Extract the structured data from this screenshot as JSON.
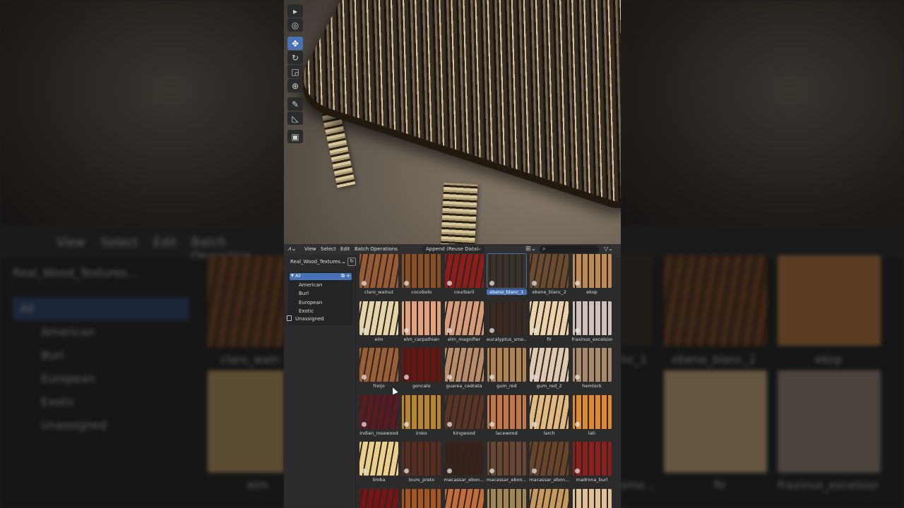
{
  "background_left": {
    "menu": [
      "View",
      "Select",
      "Edit",
      "Batch Operation"
    ],
    "library": "Real_Wood_Textures...",
    "categories": [
      "All",
      "American",
      "Burl",
      "European",
      "Exotic",
      "Unassigned"
    ],
    "labels": [
      "claro_waln",
      "elm"
    ]
  },
  "background_right": {
    "labels": [
      "nc_1",
      "ebene_blanc_2",
      "ekop",
      "smo...",
      "fir",
      "fraxinus_excelsior"
    ]
  },
  "viewport": {
    "tools": [
      "select-box",
      "cursor",
      "move",
      "rotate",
      "scale",
      "transform",
      "annotate",
      "measure",
      "add-cube"
    ],
    "active_tool": "move"
  },
  "asset_browser": {
    "menu": [
      "View",
      "Select",
      "Edit",
      "Batch Operations"
    ],
    "import_method": "Append (Reuse Data)",
    "library": "Real_Wood_Textures...",
    "categories": {
      "all": "All",
      "items": [
        "American",
        "Burl",
        "European",
        "Exotic"
      ],
      "unassigned": "Unassigned"
    },
    "assets": [
      {
        "name": "claro_walnut",
        "swatch": "#9a5a33"
      },
      {
        "name": "cocobolo",
        "swatch": "#8a4f25"
      },
      {
        "name": "courbaril",
        "swatch": "#8e1d1a"
      },
      {
        "name": "ebene_blanc_1",
        "swatch": "#3b332a",
        "selected": true
      },
      {
        "name": "ebene_blanc_2",
        "swatch": "#6b4a2e"
      },
      {
        "name": "ekop",
        "swatch": "#c08a55"
      },
      {
        "name": "elm",
        "swatch": "#e6d3a6"
      },
      {
        "name": "elm_carpathian",
        "swatch": "#e2a07c"
      },
      {
        "name": "elm_magnifier",
        "swatch": "#d89b78"
      },
      {
        "name": "eucalyptus_smo...",
        "swatch": "#3a2a22"
      },
      {
        "name": "fir",
        "swatch": "#ecd2a8"
      },
      {
        "name": "fraxinus_excelsior",
        "swatch": "#cfc1b9"
      },
      {
        "name": "freijo",
        "swatch": "#9b5e35"
      },
      {
        "name": "goncalo",
        "swatch": "#6a1410"
      },
      {
        "name": "guarea_cedrata",
        "swatch": "#b98b66"
      },
      {
        "name": "gum_red",
        "swatch": "#b08452"
      },
      {
        "name": "gum_red_2",
        "swatch": "#e0c9ae"
      },
      {
        "name": "hemlock",
        "swatch": "#a88a6a"
      },
      {
        "name": "indian_rosewood",
        "swatch": "#5a1a22"
      },
      {
        "name": "iroko",
        "swatch": "#b98430"
      },
      {
        "name": "kingwood",
        "swatch": "#5a3322"
      },
      {
        "name": "lacewood",
        "swatch": "#c2764a"
      },
      {
        "name": "larch",
        "swatch": "#e2ba80"
      },
      {
        "name": "lati",
        "swatch": "#e08a30"
      },
      {
        "name": "limba",
        "swatch": "#ecd08a"
      },
      {
        "name": "louro_preto",
        "swatch": "#5a2e1e"
      },
      {
        "name": "macassar_ebon...",
        "swatch": "#3a2218"
      },
      {
        "name": "macassar_ebon...",
        "swatch": "#6a4632"
      },
      {
        "name": "macassar_ebon...",
        "swatch": "#6a4428"
      },
      {
        "name": "madrona_burl",
        "swatch": "#8c1f1c"
      },
      {
        "name": "",
        "swatch": "#7a1414"
      },
      {
        "name": "",
        "swatch": "#a5551f"
      },
      {
        "name": "",
        "swatch": "#c26d3a"
      },
      {
        "name": "",
        "swatch": "#a18656"
      },
      {
        "name": "",
        "swatch": "#c79a5c"
      },
      {
        "name": "",
        "swatch": "#e2c196"
      }
    ]
  }
}
